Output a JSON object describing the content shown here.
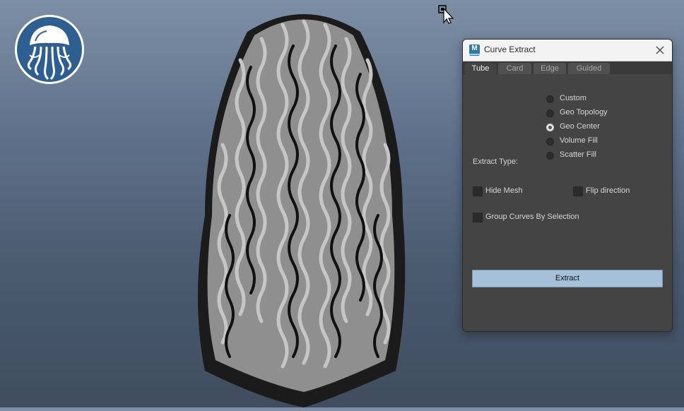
{
  "dialog": {
    "title": "Curve Extract",
    "app_icon_letter": "M",
    "tabs": [
      {
        "label": "Tube",
        "active": true
      },
      {
        "label": "Card",
        "active": false
      },
      {
        "label": "Edge",
        "active": false
      },
      {
        "label": "Guided",
        "active": false
      }
    ],
    "extract_type": {
      "label": "Extract Type:",
      "options": [
        {
          "label": "Custom",
          "checked": false
        },
        {
          "label": "Geo Topology",
          "checked": false
        },
        {
          "label": "Geo Center",
          "checked": true
        },
        {
          "label": "Volume Fill",
          "checked": false
        },
        {
          "label": "Scatter Fill",
          "checked": false
        }
      ]
    },
    "options": {
      "hide_mesh": "Hide Mesh",
      "flip_direction": "Flip direction",
      "group_curves": "Group Curves By Selection"
    },
    "extract_button": "Extract"
  },
  "colors": {
    "accent_button": "#a6c0d9",
    "logo_blue": "#2e5f93",
    "dialog_bg": "#444444"
  }
}
